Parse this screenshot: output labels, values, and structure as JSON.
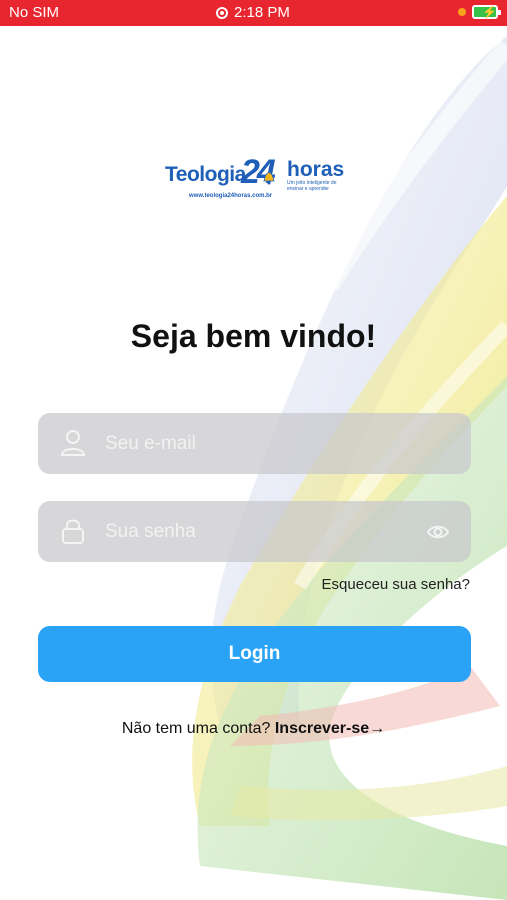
{
  "status_bar": {
    "carrier": "No SIM",
    "time": "2:18 PM"
  },
  "logo": {
    "brand_part1": "Teologia",
    "brand_number": "24",
    "brand_part2": "horas",
    "tagline": "Um jeito inteligente de ensinar e aprender",
    "url": "www.teologia24horas.com.br"
  },
  "login": {
    "title": "Seja bem vindo!",
    "email_placeholder": "Seu e-mail",
    "password_placeholder": "Sua senha",
    "forgot_password": "Esqueceu sua senha?",
    "login_button": "Login",
    "signup_prompt": "Não tem uma conta?",
    "signup_link": "Inscrever-se",
    "signup_arrow": "→"
  },
  "colors": {
    "status_bar": "#e8262f",
    "accent": "#2aa3f7",
    "brand": "#1f5fb8"
  }
}
